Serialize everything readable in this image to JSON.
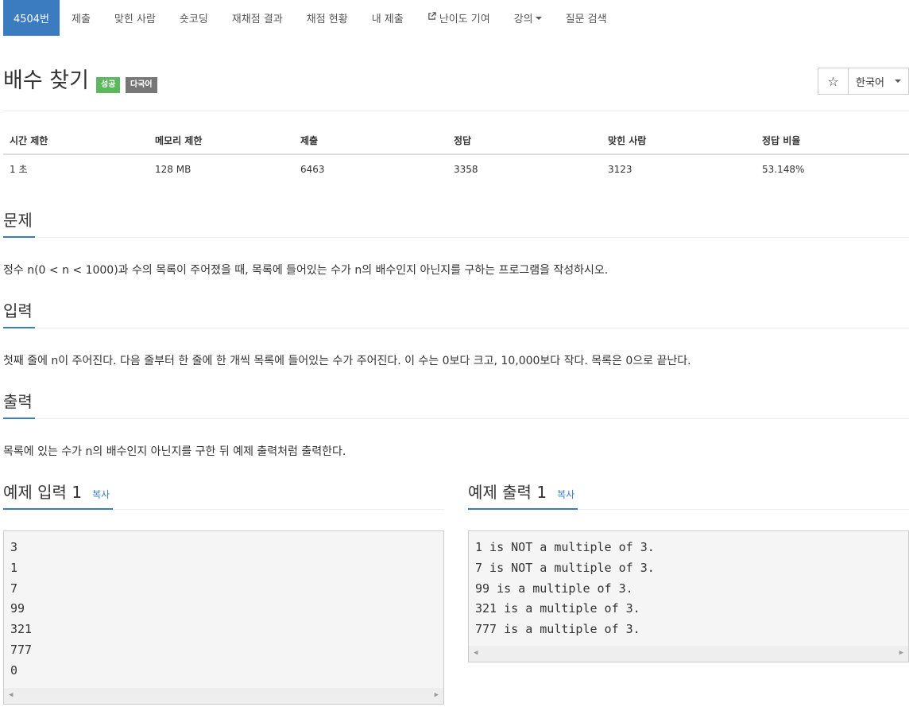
{
  "nav": {
    "items": [
      {
        "label": "4504번",
        "active": true
      },
      {
        "label": "제출"
      },
      {
        "label": "맞힌 사람"
      },
      {
        "label": "숏코딩"
      },
      {
        "label": "재채점 결과"
      },
      {
        "label": "채점 현황"
      },
      {
        "label": "내 제출"
      },
      {
        "label": "난이도 기여",
        "icon": "external-link-icon"
      },
      {
        "label": "강의",
        "dropdown": true
      },
      {
        "label": "질문 검색"
      }
    ]
  },
  "problem": {
    "title": "배수 찾기",
    "badges": {
      "status": "성공",
      "language": "다국어"
    },
    "star": "☆",
    "language_select": "한국어"
  },
  "info": {
    "headers": [
      "시간 제한",
      "메모리 제한",
      "제출",
      "정답",
      "맞힌 사람",
      "정답 비율"
    ],
    "values": [
      "1 초",
      "128 MB",
      "6463",
      "3358",
      "3123",
      "53.148%"
    ]
  },
  "sections": {
    "problem": {
      "title": "문제",
      "text": "정수 n(0 < n < 1000)과 수의 목록이 주어졌을 때, 목록에 들어있는 수가 n의 배수인지 아닌지를 구하는 프로그램을 작성하시오."
    },
    "input": {
      "title": "입력",
      "text": "첫째 줄에 n이 주어진다. 다음 줄부터 한 줄에 한 개씩 목록에 들어있는 수가 주어진다. 이 수는 0보다 크고, 10,000보다 작다. 목록은 0으로 끝난다."
    },
    "output": {
      "title": "출력",
      "text": "목록에 있는 수가 n의 배수인지 아닌지를 구한 뒤 예제 출력처럼 출력한다."
    }
  },
  "samples": {
    "input": {
      "title": "예제 입력 1",
      "copy": "복사",
      "text": "3\n1\n7\n99\n321\n777\n0"
    },
    "output": {
      "title": "예제 출력 1",
      "copy": "복사",
      "text": "1 is NOT a multiple of 3.\n7 is NOT a multiple of 3.\n99 is a multiple of 3.\n321 is a multiple of 3.\n777 is a multiple of 3."
    }
  },
  "colors": {
    "accent": "#3b7bbf",
    "success": "#5cb85c",
    "muted": "#777777"
  }
}
